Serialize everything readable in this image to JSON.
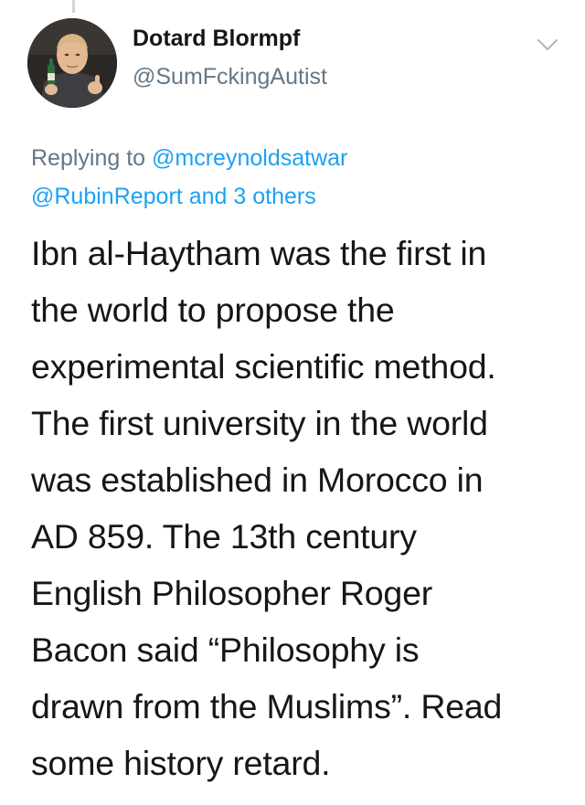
{
  "tweet": {
    "author": {
      "display_name": "Dotard Blormpf",
      "handle": "@SumFckingAutist",
      "avatar_icon": "avatar-photo"
    },
    "menu_icon": "chevron-down-icon",
    "replying": {
      "prefix": "Replying to",
      "mention_1": "@mcreynoldsatwar",
      "mention_2": "@RubinReport",
      "joiner": "and",
      "others": "3 others"
    },
    "text_lines": [
      "Ibn al-Haytham was the first in",
      "the world to propose the",
      "experimental scientific method.",
      "The first university in the world",
      "was established in Morocco in",
      "AD 859. The 13th century",
      "English Philosopher Roger",
      "Bacon said “Philosophy is",
      "drawn from the Muslims”. Read",
      "some history retard."
    ]
  },
  "colors": {
    "link": "#1da1f2",
    "secondary_text": "#657786",
    "primary_text": "#14171a",
    "thread_line": "#ccd6dd"
  }
}
